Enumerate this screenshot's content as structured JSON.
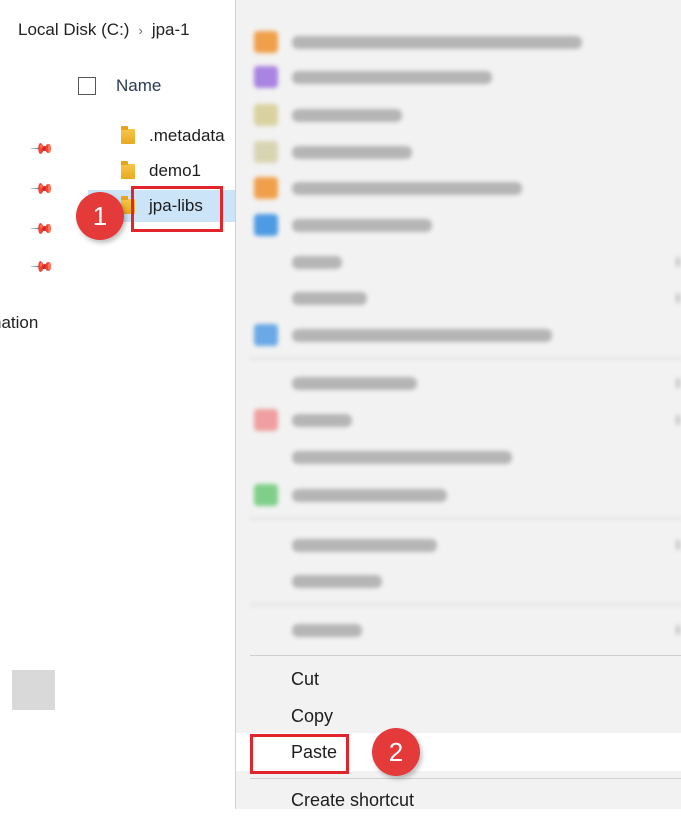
{
  "explorer": {
    "breadcrumb": [
      "Local Disk (C:)",
      "jpa-1"
    ],
    "breadcrumb_sep": "›",
    "column_header": "Name",
    "files": [
      {
        "name": ".metadata",
        "selected": false
      },
      {
        "name": "demo1",
        "selected": false
      },
      {
        "name": "jpa-libs",
        "selected": true
      }
    ],
    "nav_label_fragment": "nation",
    "pin_icon": "pin-icon"
  },
  "annotations": {
    "step1": "1",
    "step2": "2",
    "color": "#e2242b"
  },
  "context_menu": {
    "items": [
      "Cut",
      "Copy",
      "Paste",
      "Create shortcut"
    ],
    "highlighted": "Paste"
  },
  "colors": {
    "selection": "#cce4f7",
    "menu_bg": "#f2f2f2",
    "callout_red": "#e2242b"
  }
}
